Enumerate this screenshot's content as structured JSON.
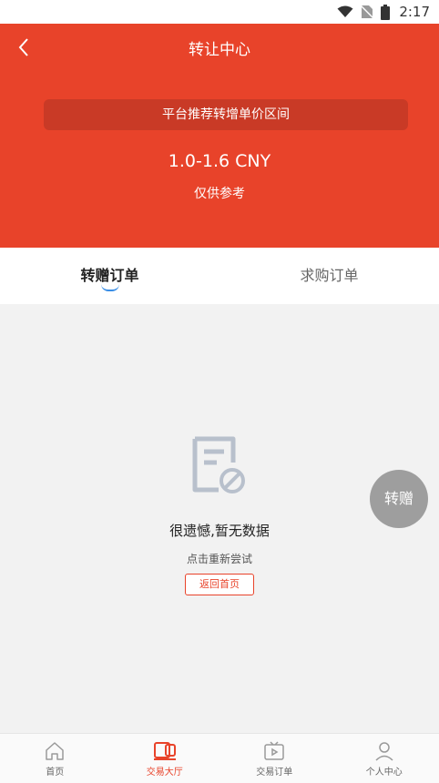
{
  "status_bar": {
    "time": "2:17"
  },
  "header": {
    "title": "转让中心",
    "range_label": "平台推荐转增单价区间",
    "range_value": "1.0-1.6 CNY",
    "range_note": "仅供参考"
  },
  "tabs": [
    {
      "label": "转赠订单",
      "active": true
    },
    {
      "label": "求购订单",
      "active": false
    }
  ],
  "empty_state": {
    "title": "很遗憾,暂无数据",
    "subtitle": "点击重新尝试",
    "home_button": "返回首页"
  },
  "fab": {
    "label": "转赠"
  },
  "bottom_nav": [
    {
      "label": "首页",
      "icon": "home-icon",
      "active": false
    },
    {
      "label": "交易大厅",
      "icon": "trading-hall-icon",
      "active": true
    },
    {
      "label": "交易订单",
      "icon": "orders-play-icon",
      "active": false
    },
    {
      "label": "个人中心",
      "icon": "person-icon",
      "active": false
    }
  ],
  "colors": {
    "accent": "#e8432a",
    "tab_indicator": "#3a8ee6",
    "fab": "#9e9e9e"
  }
}
